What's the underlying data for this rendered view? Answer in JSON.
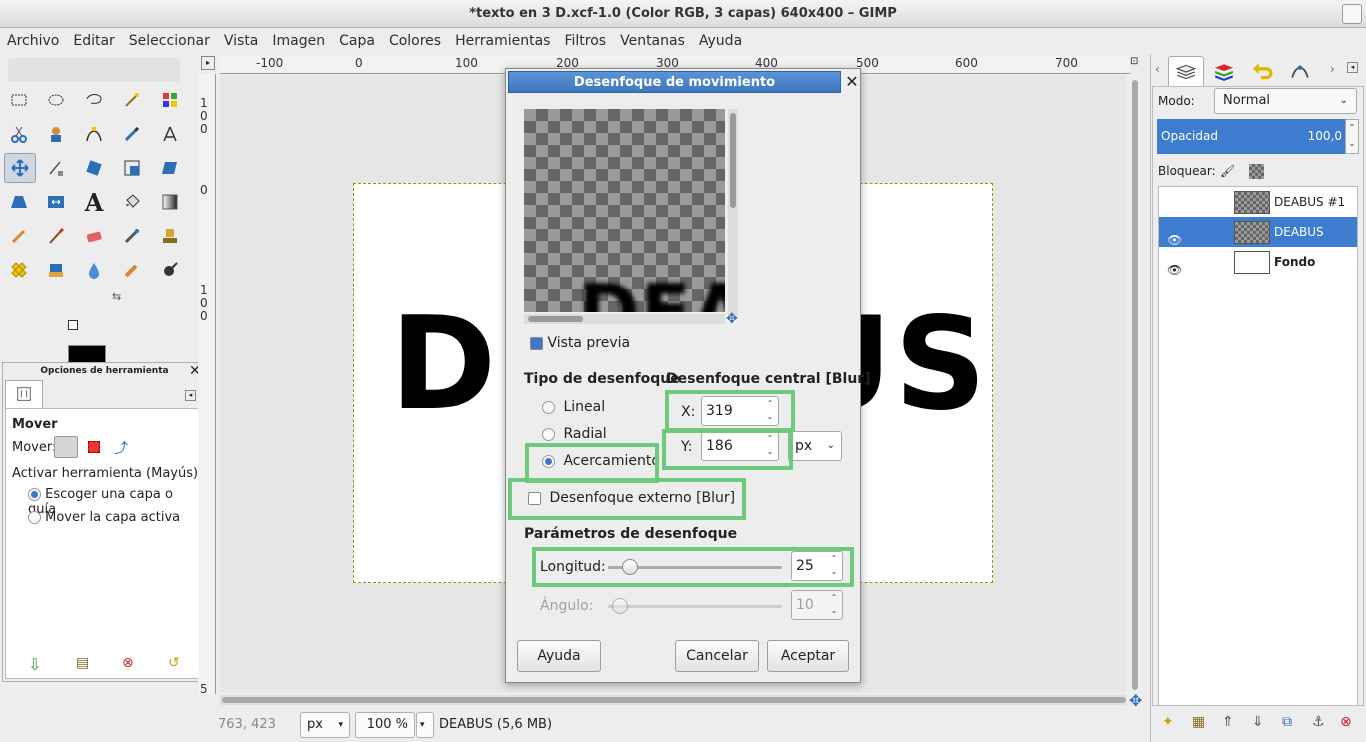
{
  "window": {
    "title": "*texto en 3 D.xcf-1.0 (Color RGB, 3 capas) 640x400 – GIMP"
  },
  "menu": [
    "Archivo",
    "Editar",
    "Seleccionar",
    "Vista",
    "Imagen",
    "Capa",
    "Colores",
    "Herramientas",
    "Filtros",
    "Ventanas",
    "Ayuda"
  ],
  "ruler": {
    "top": [
      "-100",
      "0",
      "100",
      "200",
      "300",
      "400",
      "500",
      "600",
      "700"
    ],
    "left": [
      "1",
      "0",
      "0",
      "0",
      "1",
      "0",
      "0",
      "5"
    ]
  },
  "canvas": {
    "text": "DEABUS"
  },
  "tool_options": {
    "title": "Opciones de herramienta",
    "tool_name": "Mover",
    "move_label": "Mover:",
    "activate_label": "Activar herramienta  (Mayús)",
    "options": [
      "Escoger una capa o guía",
      "Mover la capa activa"
    ],
    "selected": 0
  },
  "status": {
    "coords": "763, 423",
    "unit": "px",
    "zoom": "100 %",
    "layer_info": "DEABUS (5,6 MB)"
  },
  "layers": {
    "mode_label": "Modo:",
    "mode_value": "Normal",
    "opacity_label": "Opacidad",
    "opacity_value": "100,0",
    "lock_label": "Bloquear:",
    "items": [
      {
        "name": "DEABUS #1",
        "visible": false,
        "selected": false
      },
      {
        "name": "DEABUS",
        "visible": true,
        "selected": true
      },
      {
        "name": "Fondo",
        "visible": true,
        "selected": false
      }
    ]
  },
  "dialog": {
    "title": "Desenfoque de movimiento",
    "preview_text": "DEA",
    "preview_label": "Vista previa",
    "blur_type_label": "Tipo de desenfoque",
    "blur_types": [
      "Lineal",
      "Radial",
      "Acercamiento"
    ],
    "blur_type_selected": 2,
    "center_label": "Desenfoque central [Blur]",
    "x_label": "X:",
    "x_value": "319",
    "y_label": "Y:",
    "y_value": "186",
    "unit_partial": "px",
    "outer_label": "Desenfoque externo [Blur]",
    "params_label": "Parámetros de desenfoque",
    "length_label": "Longitud:",
    "length_value": "25",
    "angle_label": "Ángulo:",
    "angle_value": "10",
    "help_button": "Ayuda",
    "cancel_button": "Cancelar",
    "ok_button": "Aceptar"
  },
  "colors": {
    "accent": "#3d7ccf",
    "highlight": "#6dca7d"
  }
}
